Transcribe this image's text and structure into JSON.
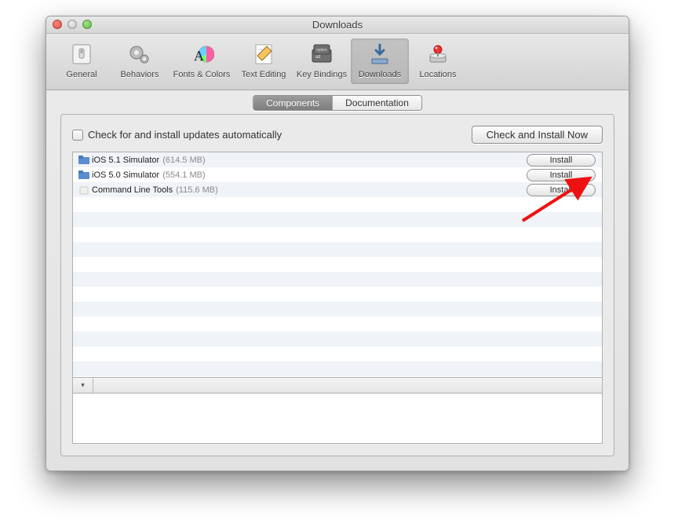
{
  "window": {
    "title": "Downloads"
  },
  "toolbar": {
    "items": [
      {
        "label": "General"
      },
      {
        "label": "Behaviors"
      },
      {
        "label": "Fonts & Colors"
      },
      {
        "label": "Text Editing"
      },
      {
        "label": "Key Bindings"
      },
      {
        "label": "Downloads"
      },
      {
        "label": "Locations"
      }
    ]
  },
  "tabs": {
    "components": "Components",
    "documentation": "Documentation"
  },
  "controls": {
    "auto_update_label": "Check for and install updates automatically",
    "check_now": "Check and Install Now",
    "install": "Install"
  },
  "components": [
    {
      "name": "iOS 5.1 Simulator",
      "size": "(614.5 MB)",
      "icon": "folder"
    },
    {
      "name": "iOS 5.0 Simulator",
      "size": "(554.1 MB)",
      "icon": "folder"
    },
    {
      "name": "Command Line Tools",
      "size": "(115.6 MB)",
      "icon": "package"
    }
  ]
}
